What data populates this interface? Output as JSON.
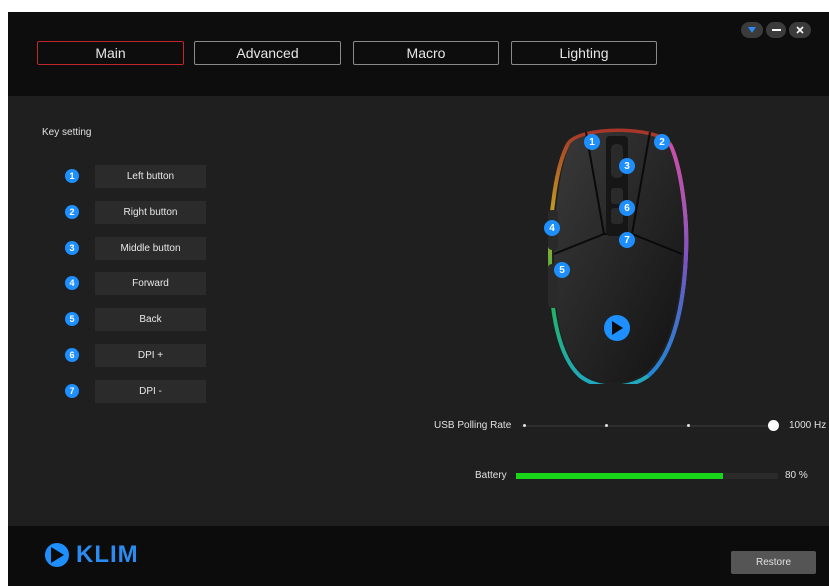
{
  "tabs": [
    {
      "label": "Main",
      "active": true
    },
    {
      "label": "Advanced",
      "active": false
    },
    {
      "label": "Macro",
      "active": false
    },
    {
      "label": "Lighting",
      "active": false
    }
  ],
  "window_controls": {
    "dropdown_icon": "chevron-down-icon",
    "minimize_icon": "minimize-icon",
    "close_icon": "close-icon"
  },
  "key_setting": {
    "title": "Key setting",
    "keys": [
      {
        "number": "1",
        "label": "Left button"
      },
      {
        "number": "2",
        "label": "Right button"
      },
      {
        "number": "3",
        "label": "Middle button"
      },
      {
        "number": "4",
        "label": "Forward"
      },
      {
        "number": "5",
        "label": "Back"
      },
      {
        "number": "6",
        "label": "DPI +"
      },
      {
        "number": "7",
        "label": "DPI -"
      }
    ]
  },
  "mouse_markers": [
    "1",
    "2",
    "3",
    "4",
    "5",
    "6",
    "7"
  ],
  "polling": {
    "label": "USB Polling Rate",
    "value": "1000 Hz",
    "level": 1.0
  },
  "battery": {
    "label": "Battery",
    "value": "80 %",
    "level": 0.8
  },
  "footer": {
    "logo_text": "KLIM",
    "restore_label": "Restore"
  },
  "colors": {
    "accent_blue": "#1e8fff",
    "active_tab_border": "#c0262b",
    "battery_green": "#18d618"
  }
}
